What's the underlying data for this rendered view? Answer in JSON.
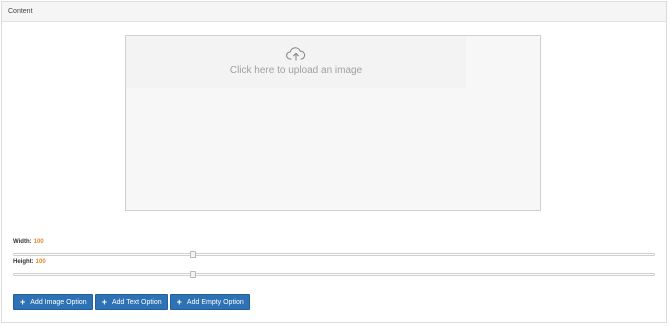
{
  "panel": {
    "title": "Content"
  },
  "upload": {
    "text": "Click here to upload an image",
    "icon": "cloud-upload-icon"
  },
  "fields": {
    "width": {
      "label": "Width:",
      "value": "100",
      "slider_fraction": 0.28
    },
    "height": {
      "label": "Height:",
      "value": "100",
      "slider_fraction": 0.28
    }
  },
  "buttons": [
    {
      "label": "Add Image Option",
      "icon": "plus-icon"
    },
    {
      "label": "Add Text Option",
      "icon": "plus-icon"
    },
    {
      "label": "Add Empty Option",
      "icon": "plus-icon"
    }
  ],
  "colors": {
    "primary_button": "#2c72b5",
    "value_accent": "#e8872b"
  }
}
